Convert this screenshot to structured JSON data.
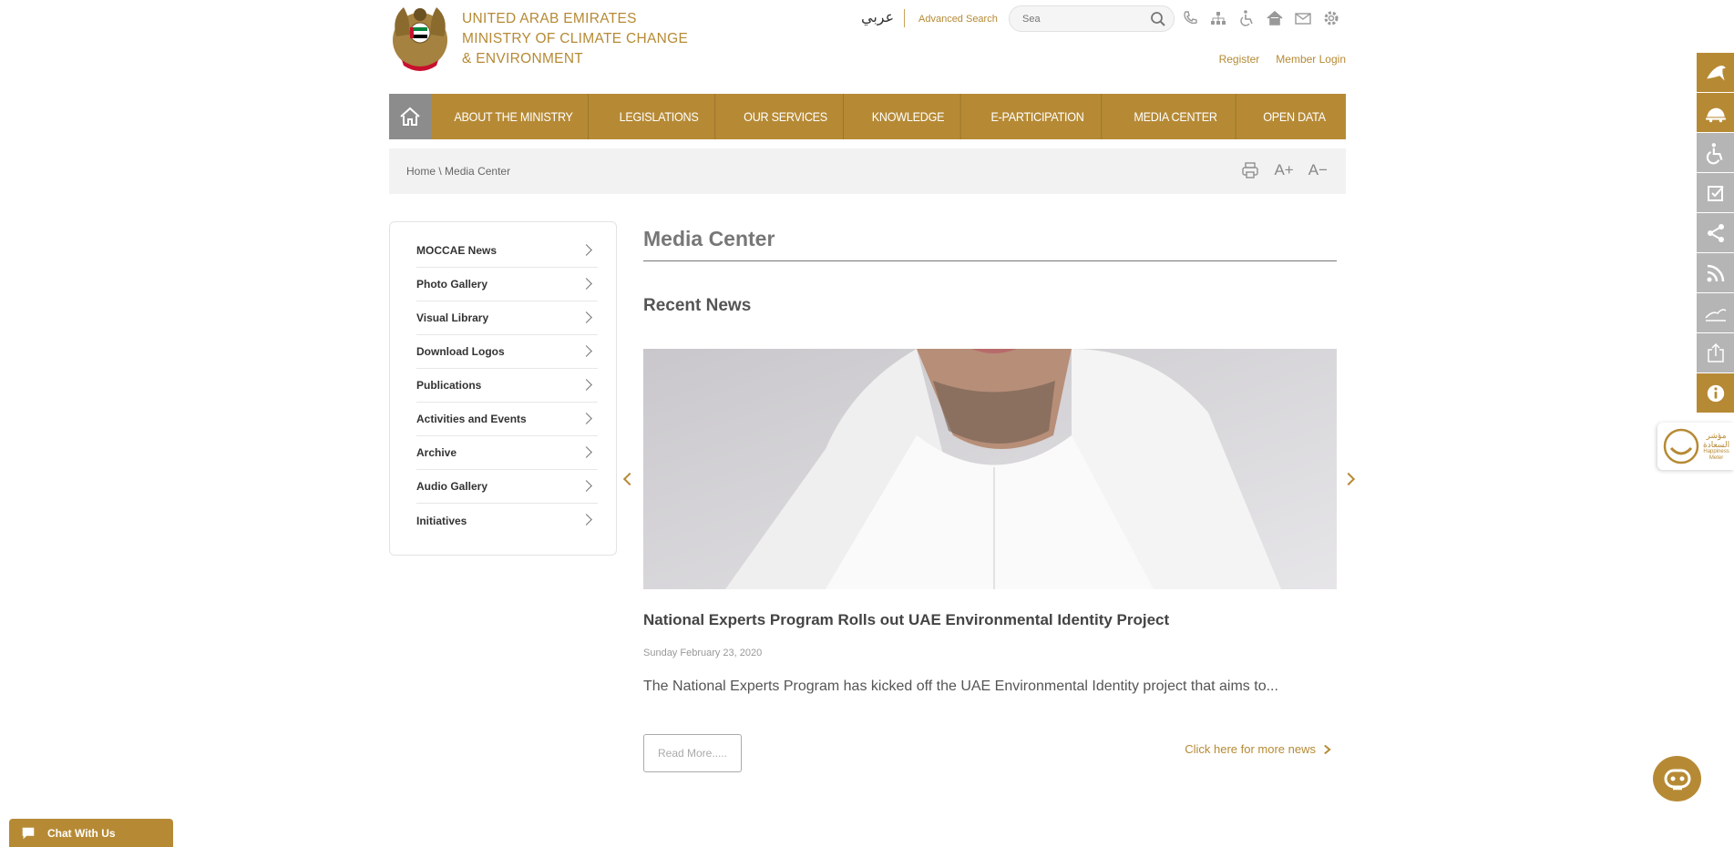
{
  "header": {
    "logo_lines": [
      "UNITED ARAB EMIRATES",
      "MINISTRY OF CLIMATE CHANGE",
      "& ENVIRONMENT"
    ],
    "language_link": "عربي",
    "advanced_search": "Advanced Search",
    "search_placeholder": "Sea",
    "top_icons": [
      "phone-icon",
      "sitemap-icon",
      "accessibility-icon",
      "home-icon",
      "mail-icon",
      "settings-icon"
    ],
    "register": "Register",
    "member_login": "Member Login"
  },
  "nav": {
    "items": [
      "ABOUT THE MINISTRY",
      "LEGISLATIONS",
      "OUR SERVICES",
      "KNOWLEDGE",
      "E-PARTICIPATION",
      "MEDIA CENTER",
      "OPEN DATA"
    ]
  },
  "breadcrumb": {
    "home": "Home",
    "separator": "\\",
    "current": "Media Center",
    "font_increase": "A+",
    "font_decrease": "A−"
  },
  "sidebar": {
    "items": [
      "MOCCAE News",
      "Photo Gallery",
      "Visual Library",
      "Download Logos",
      "Publications",
      "Activities and Events",
      "Archive",
      "Audio Gallery",
      "Initiatives"
    ]
  },
  "main": {
    "title": "Media Center",
    "section": "Recent News",
    "news": {
      "title": "National Experts Program Rolls out UAE Environmental Identity Project",
      "date": "Sunday February 23, 2020",
      "excerpt": "The National Experts Program has kicked off the UAE Environmental Identity project that aims to...",
      "read_more": "Read More.....",
      "more_news": "Click here for more news"
    }
  },
  "rail_icons": [
    "falcon-icon",
    "tortoise-icon",
    "wheelchair-icon",
    "checklist-icon",
    "share-icon",
    "rss-icon",
    "dunes-icon",
    "export-icon",
    "info-icon"
  ],
  "happiness": {
    "line1": "مؤشر",
    "line2": "السعادة",
    "line3": "Happiness",
    "line4": "Meter"
  },
  "chat": {
    "label": "Chat With Us"
  },
  "colors": {
    "gold": "#b68a35",
    "grey": "#8c8c8c",
    "crumb_bg": "#f2f2f2"
  }
}
